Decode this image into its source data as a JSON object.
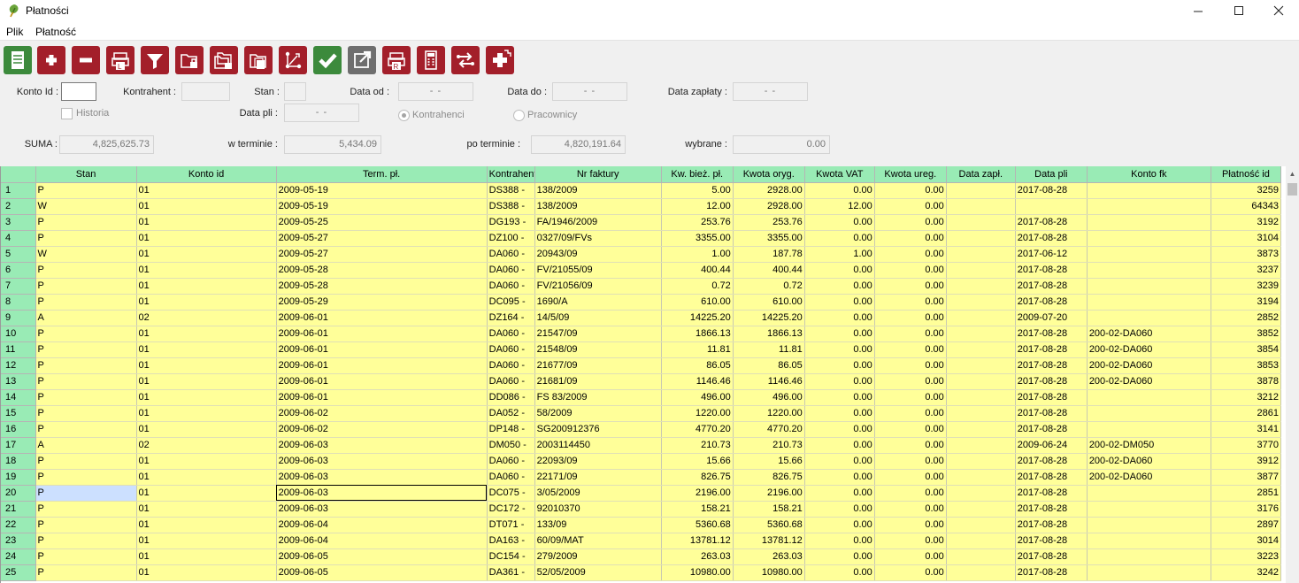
{
  "window": {
    "title": "Płatności",
    "minimize_icon": "minimize-icon",
    "maximize_icon": "maximize-icon",
    "close_icon": "close-icon"
  },
  "menu": [
    "Plik",
    "Płatność"
  ],
  "toolbar": [
    {
      "name": "list-view-button",
      "icon": "document-list-icon",
      "color": "#3c8a3c"
    },
    {
      "name": "add-button",
      "icon": "plus-icon",
      "color": "#a31f2a"
    },
    {
      "name": "delete-button",
      "icon": "minus-icon",
      "color": "#a31f2a"
    },
    {
      "name": "print-l-button",
      "icon": "printer-l-icon",
      "color": "#a31f2a"
    },
    {
      "name": "filter-button",
      "icon": "filter-icon",
      "color": "#a31f2a"
    },
    {
      "name": "lock-folder-button",
      "icon": "folder-lock-icon",
      "color": "#a31f2a"
    },
    {
      "name": "lock-folders-button",
      "icon": "folders-lock-icon",
      "color": "#a31f2a"
    },
    {
      "name": "folder-copy-button",
      "icon": "folder-copy-icon",
      "color": "#a31f2a"
    },
    {
      "name": "link-button",
      "icon": "branch-icon",
      "color": "#a31f2a"
    },
    {
      "name": "accept-button",
      "icon": "check-icon",
      "color": "#3c8a3c"
    },
    {
      "name": "export-button",
      "icon": "export-icon",
      "color": "#6e6e6e"
    },
    {
      "name": "print-r-button",
      "icon": "printer-r-icon",
      "color": "#a31f2a"
    },
    {
      "name": "calculator-button",
      "icon": "calculator-icon",
      "color": "#a31f2a"
    },
    {
      "name": "swap-button",
      "icon": "swap-icon",
      "color": "#a31f2a"
    },
    {
      "name": "add-multiple-button",
      "icon": "plus-multi-icon",
      "color": "#a31f2a"
    }
  ],
  "filters": {
    "konto_id_label": "Konto Id :",
    "konto_id_value": "",
    "kontrahent_label": "Kontrahent :",
    "kontrahent_value": "",
    "stan_label": "Stan :",
    "stan_value": "",
    "data_od_label": "Data od :",
    "data_od_value": "-  -",
    "data_do_label": "Data do :",
    "data_do_value": "-  -",
    "data_zaplaty_label": "Data zapłaty :",
    "data_zaplaty_value": "-  -",
    "historia_label": "Historia",
    "historia_checked": false,
    "data_pli_label": "Data pli :",
    "data_pli_value": "-  -",
    "kontrahenci_label": "Kontrahenci",
    "pracownicy_label": "Pracownicy",
    "selected_option": "Kontrahenci"
  },
  "summary": {
    "suma_label": "SUMA :",
    "suma_value": "4,825,625.73",
    "w_terminie_label": "w terminie :",
    "w_terminie_value": "5,434.09",
    "po_terminie_label": "po terminie :",
    "po_terminie_value": "4,820,191.64",
    "wybrane_label": "wybrane :",
    "wybrane_value": "0.00"
  },
  "table": {
    "columns": [
      "",
      "Stan",
      "Konto id",
      "Term. pł.",
      "Kontrahent",
      "Nr faktury",
      "Kw. bież. pł.",
      "Kwota oryg.",
      "Kwota VAT",
      "Kwota ureg.",
      "Data zapł.",
      "Data pli",
      "Konto fk",
      "Płatność id"
    ],
    "rows": [
      [
        "1",
        "P",
        "01",
        "2009-05-19",
        "DS388 -",
        "138/2009",
        "5.00",
        "2928.00",
        "0.00",
        "0.00",
        "",
        "2017-08-28",
        "",
        "3259"
      ],
      [
        "2",
        "W",
        "01",
        "2009-05-19",
        "DS388 -",
        "138/2009",
        "12.00",
        "2928.00",
        "12.00",
        "0.00",
        "",
        "",
        "",
        "64343"
      ],
      [
        "3",
        "P",
        "01",
        "2009-05-25",
        "DG193 -",
        "FA/1946/2009",
        "253.76",
        "253.76",
        "0.00",
        "0.00",
        "",
        "2017-08-28",
        "",
        "3192"
      ],
      [
        "4",
        "P",
        "01",
        "2009-05-27",
        "DZ100 -",
        "0327/09/FVs",
        "3355.00",
        "3355.00",
        "0.00",
        "0.00",
        "",
        "2017-08-28",
        "",
        "3104"
      ],
      [
        "5",
        "W",
        "01",
        "2009-05-27",
        "DA060 -",
        "20943/09",
        "1.00",
        "187.78",
        "1.00",
        "0.00",
        "",
        "2017-06-12",
        "",
        "3873"
      ],
      [
        "6",
        "P",
        "01",
        "2009-05-28",
        "DA060 -",
        "FV/21055/09",
        "400.44",
        "400.44",
        "0.00",
        "0.00",
        "",
        "2017-08-28",
        "",
        "3237"
      ],
      [
        "7",
        "P",
        "01",
        "2009-05-28",
        "DA060 -",
        "FV/21056/09",
        "0.72",
        "0.72",
        "0.00",
        "0.00",
        "",
        "2017-08-28",
        "",
        "3239"
      ],
      [
        "8",
        "P",
        "01",
        "2009-05-29",
        "DC095 -",
        "1690/A",
        "610.00",
        "610.00",
        "0.00",
        "0.00",
        "",
        "2017-08-28",
        "",
        "3194"
      ],
      [
        "9",
        "A",
        "02",
        "2009-06-01",
        "DZ164 -",
        "14/5/09",
        "14225.20",
        "14225.20",
        "0.00",
        "0.00",
        "",
        "2009-07-20",
        "",
        "2852"
      ],
      [
        "10",
        "P",
        "01",
        "2009-06-01",
        "DA060 -",
        "21547/09",
        "1866.13",
        "1866.13",
        "0.00",
        "0.00",
        "",
        "2017-08-28",
        "200-02-DA060",
        "3852"
      ],
      [
        "11",
        "P",
        "01",
        "2009-06-01",
        "DA060 -",
        "21548/09",
        "11.81",
        "11.81",
        "0.00",
        "0.00",
        "",
        "2017-08-28",
        "200-02-DA060",
        "3854"
      ],
      [
        "12",
        "P",
        "01",
        "2009-06-01",
        "DA060 -",
        "21677/09",
        "86.05",
        "86.05",
        "0.00",
        "0.00",
        "",
        "2017-08-28",
        "200-02-DA060",
        "3853"
      ],
      [
        "13",
        "P",
        "01",
        "2009-06-01",
        "DA060 -",
        "21681/09",
        "1146.46",
        "1146.46",
        "0.00",
        "0.00",
        "",
        "2017-08-28",
        "200-02-DA060",
        "3878"
      ],
      [
        "14",
        "P",
        "01",
        "2009-06-01",
        "DD086 -",
        "FS 83/2009",
        "496.00",
        "496.00",
        "0.00",
        "0.00",
        "",
        "2017-08-28",
        "",
        "3212"
      ],
      [
        "15",
        "P",
        "01",
        "2009-06-02",
        "DA052 -",
        "58/2009",
        "1220.00",
        "1220.00",
        "0.00",
        "0.00",
        "",
        "2017-08-28",
        "",
        "2861"
      ],
      [
        "16",
        "P",
        "01",
        "2009-06-02",
        "DP148 -",
        "SG200912376",
        "4770.20",
        "4770.20",
        "0.00",
        "0.00",
        "",
        "2017-08-28",
        "",
        "3141"
      ],
      [
        "17",
        "A",
        "02",
        "2009-06-03",
        "DM050 -",
        "2003114450",
        "210.73",
        "210.73",
        "0.00",
        "0.00",
        "",
        "2009-06-24",
        "200-02-DM050",
        "3770"
      ],
      [
        "18",
        "P",
        "01",
        "2009-06-03",
        "DA060 -",
        "22093/09",
        "15.66",
        "15.66",
        "0.00",
        "0.00",
        "",
        "2017-08-28",
        "200-02-DA060",
        "3912"
      ],
      [
        "19",
        "P",
        "01",
        "2009-06-03",
        "DA060 -",
        "22171/09",
        "826.75",
        "826.75",
        "0.00",
        "0.00",
        "",
        "2017-08-28",
        "200-02-DA060",
        "3877"
      ],
      [
        "20",
        "P",
        "01",
        "2009-06-03",
        "DC075 -",
        "3/05/2009",
        "2196.00",
        "2196.00",
        "0.00",
        "0.00",
        "",
        "2017-08-28",
        "",
        "2851"
      ],
      [
        "21",
        "P",
        "01",
        "2009-06-03",
        "DC172 -",
        "92010370",
        "158.21",
        "158.21",
        "0.00",
        "0.00",
        "",
        "2017-08-28",
        "",
        "3176"
      ],
      [
        "22",
        "P",
        "01",
        "2009-06-04",
        "DT071 -",
        "133/09",
        "5360.68",
        "5360.68",
        "0.00",
        "0.00",
        "",
        "2017-08-28",
        "",
        "2897"
      ],
      [
        "23",
        "P",
        "01",
        "2009-06-04",
        "DA163 -",
        "60/09/MAT",
        "13781.12",
        "13781.12",
        "0.00",
        "0.00",
        "",
        "2017-08-28",
        "",
        "3014"
      ],
      [
        "24",
        "P",
        "01",
        "2009-06-05",
        "DC154 -",
        "279/2009",
        "263.03",
        "263.03",
        "0.00",
        "0.00",
        "",
        "2017-08-28",
        "",
        "3223"
      ],
      [
        "25",
        "P",
        "01",
        "2009-06-05",
        "DA361 -",
        "52/05/2009",
        "10980.00",
        "10980.00",
        "0.00",
        "0.00",
        "",
        "2017-08-28",
        "",
        "3242"
      ]
    ],
    "selected_row": 20
  }
}
